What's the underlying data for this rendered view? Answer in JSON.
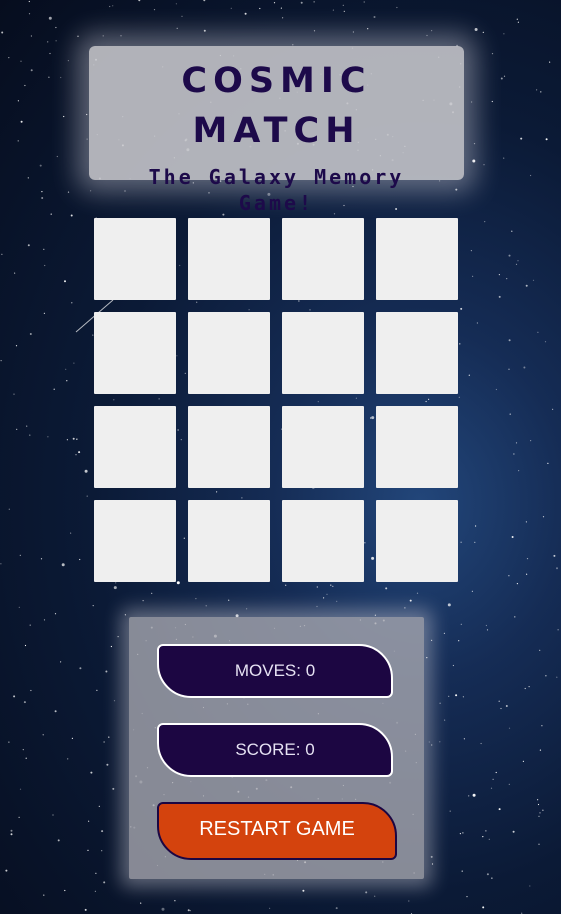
{
  "header": {
    "title": "COSMIC MATCH",
    "subtitle": "The Galaxy Memory Game!"
  },
  "board": {
    "rows": 4,
    "columns": 4,
    "cards": [
      "",
      "",
      "",
      "",
      "",
      "",
      "",
      "",
      "",
      "",
      "",
      "",
      "",
      "",
      "",
      ""
    ]
  },
  "stats": {
    "moves_label": "MOVES: 0",
    "score_label": "SCORE: 0"
  },
  "controls": {
    "restart_label": "RESTART GAME"
  },
  "colors": {
    "title_text": "#1d0a4a",
    "stat_background": "#1c0642",
    "restart_background": "#d4430d",
    "card_face": "#efefef"
  }
}
